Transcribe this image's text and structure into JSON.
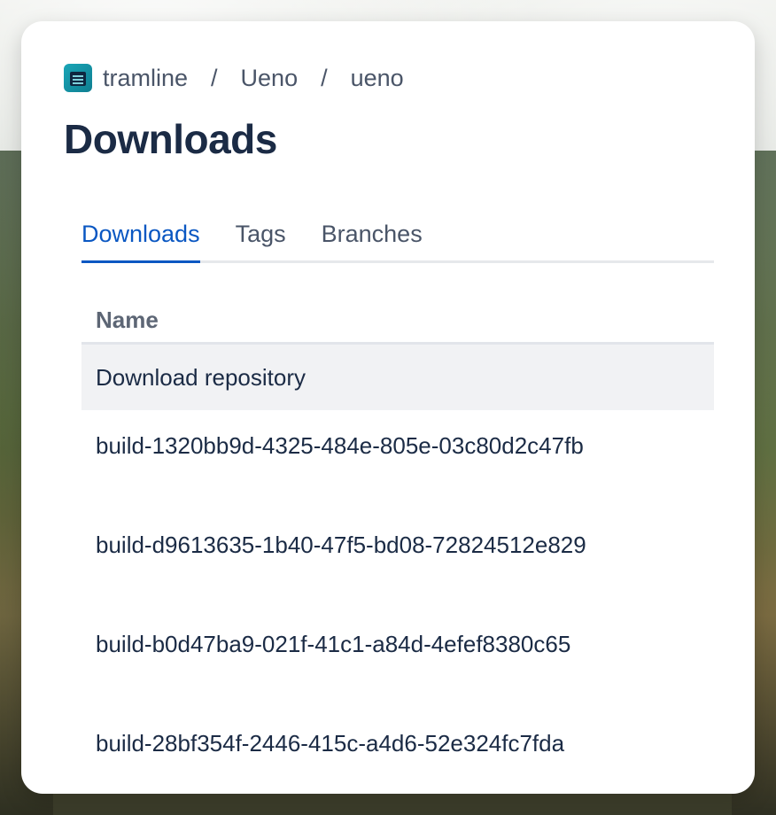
{
  "breadcrumb": {
    "items": [
      "tramline",
      "Ueno",
      "ueno"
    ],
    "separator": "/"
  },
  "page": {
    "title": "Downloads"
  },
  "tabs": [
    {
      "label": "Downloads",
      "active": true
    },
    {
      "label": "Tags",
      "active": false
    },
    {
      "label": "Branches",
      "active": false
    }
  ],
  "table": {
    "header": "Name",
    "rows": [
      "Download repository",
      "build-1320bb9d-4325-484e-805e-03c80d2c47fb",
      "build-d9613635-1b40-47f5-bd08-72824512e829",
      "build-b0d47ba9-021f-41c1-a84d-4efef8380c65",
      "build-28bf354f-2446-415c-a4d6-52e324fc7fda"
    ]
  },
  "colors": {
    "accent": "#0a57c2",
    "title": "#1b2b45",
    "muted": "#4a5568"
  }
}
